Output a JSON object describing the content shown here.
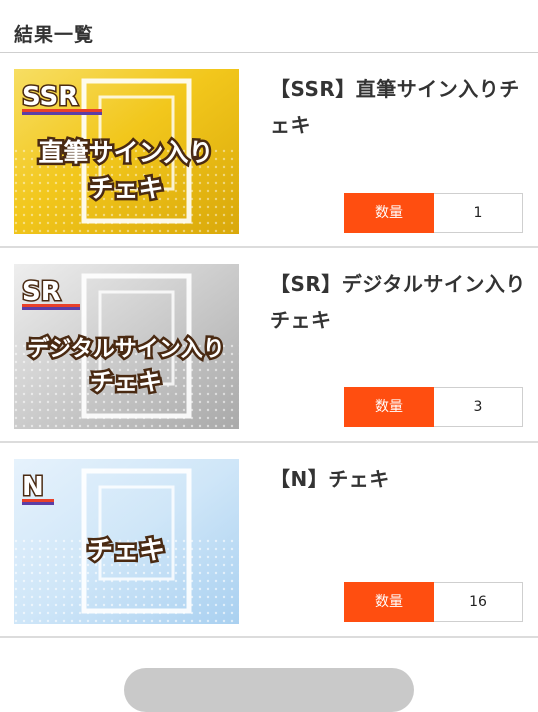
{
  "page": {
    "title": "結果一覧"
  },
  "items": [
    {
      "name": "【SSR】直筆サイン入りチェキ",
      "quantity_label": "数量",
      "quantity": "1",
      "thumbnail": {
        "rarity": "SSR",
        "caption_line1": "直筆サイン入り",
        "caption_line2": "チェキ",
        "background_color": "#f2c71c"
      }
    },
    {
      "name": "【SR】デジタルサイン入りチェキ",
      "quantity_label": "数量",
      "quantity": "3",
      "thumbnail": {
        "rarity": "SR",
        "caption_line1": "デジタルサイン入り",
        "caption_line2": "チェキ",
        "background_color": "#cfcfcf"
      }
    },
    {
      "name": "【N】チェキ",
      "quantity_label": "数量",
      "quantity": "16",
      "thumbnail": {
        "rarity": "N",
        "caption_line1": "チェキ",
        "caption_line2": "",
        "background_color": "#cfe6f8"
      }
    }
  ],
  "colors": {
    "accent": "#ff4e10",
    "divider": "#dcdcdc"
  }
}
